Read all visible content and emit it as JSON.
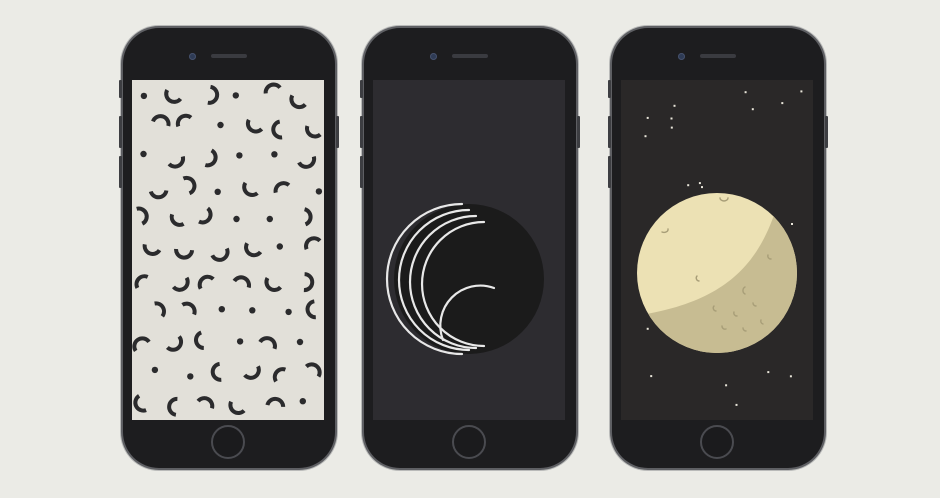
{
  "colors": {
    "background": "#ebebe6",
    "phone_body": "#1d1d1f",
    "pattern_screen_bg": "#e2e0d9",
    "pattern_ink": "#2b2b2d",
    "rings_screen_bg": "#2d2c30",
    "rings_disc": "#1b1b1b",
    "rings_stroke": "#e8e8e8",
    "moon_screen_bg": "#2a2828",
    "moon_light": "#ece1b4",
    "moon_shadow": "#c7bc92",
    "stars": "#e9e6da"
  },
  "phones": [
    {
      "wallpaper": "abstract-arcs-and-dots-pattern"
    },
    {
      "wallpaper": "concentric-rings-disc"
    },
    {
      "wallpaper": "moon-in-starry-sky"
    }
  ]
}
